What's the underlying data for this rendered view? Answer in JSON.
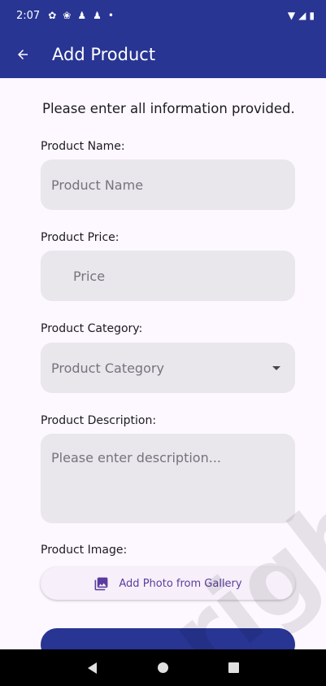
{
  "status_bar": {
    "time": "2:07",
    "icons": [
      "settings-icon",
      "fan-icon",
      "accessibility-icon",
      "accessibility-icon",
      "dot-icon"
    ],
    "right_icons": [
      "wifi-icon",
      "signal-icon",
      "battery-icon"
    ]
  },
  "app_bar": {
    "title": "Add Product",
    "back_icon": "arrow-left-icon",
    "color": "#283593"
  },
  "form": {
    "intro": "Please enter all information provided.",
    "name_label": "Product Name:",
    "name_placeholder": "Product Name",
    "price_label": "Product Price:",
    "price_placeholder": "Price",
    "category_label": "Product Category:",
    "category_placeholder": "Product Category",
    "description_label": "Product Description:",
    "description_placeholder": "Please enter description...",
    "image_label": "Product Image:",
    "add_photo_label": "Add Photo from Gallery",
    "add_photo_icon": "photo-library-icon"
  },
  "watermark": "right",
  "nav_bar": {
    "icons": [
      "back-triangle-icon",
      "home-circle-icon",
      "recents-square-icon"
    ]
  }
}
